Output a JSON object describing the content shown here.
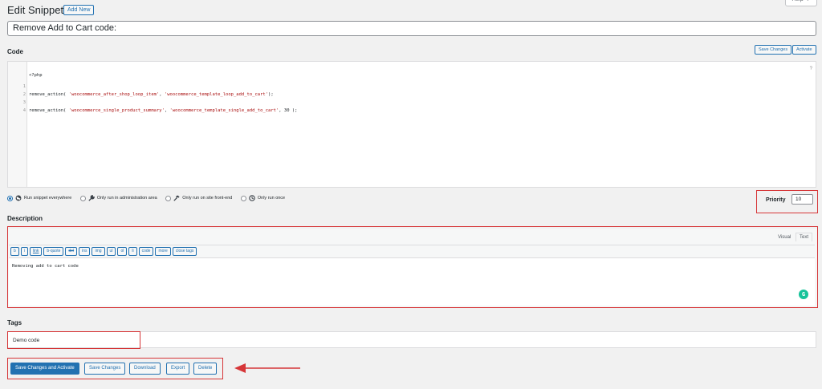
{
  "header": {
    "title": "Edit Snippet",
    "add_new": "Add New",
    "help": "Help ▼"
  },
  "snippet": {
    "name": "Remove Add to Cart code:"
  },
  "code_section": {
    "label": "Code",
    "save_changes": "Save Changes",
    "activate": "Activate",
    "php_tag": "<?php",
    "help_mark": "?",
    "lines": [
      {
        "num": "1",
        "code": "remove_action( 'woocommerce_after_shop_loop_item', 'woocommerce_template_loop_add_to_cart');"
      },
      {
        "num": "2",
        "code": ""
      },
      {
        "num": "3",
        "code": "remove_action( 'woocommerce_single_product_summary', 'woocommerce_template_single_add_to_cart', 30 );"
      },
      {
        "num": "4",
        "code": ""
      }
    ]
  },
  "scope": {
    "options": [
      {
        "label": "Run snippet everywhere",
        "icon": "globe-icon",
        "checked": true
      },
      {
        "label": "Only run in administration area",
        "icon": "wrench-icon",
        "checked": false
      },
      {
        "label": "Only run on site front-end",
        "icon": "hammer-icon",
        "checked": false
      },
      {
        "label": "Only run once",
        "icon": "clock-icon",
        "checked": false
      }
    ]
  },
  "priority": {
    "label": "Priority",
    "value": "10"
  },
  "description": {
    "label": "Description",
    "tab_visual": "Visual",
    "tab_text": "Text",
    "toolbar": [
      "b",
      "i",
      "link",
      "b-quote",
      "del",
      "ins",
      "img",
      "ul",
      "ol",
      "li",
      "code",
      "more",
      "close tags"
    ],
    "content": "Removing add to cart code",
    "grammarly": "G"
  },
  "tags": {
    "label": "Tags",
    "value": "Demo code"
  },
  "actions": {
    "save_and_activate": "Save Changes and Activate",
    "save_changes": "Save Changes",
    "download": "Download",
    "export": "Export",
    "delete": "Delete"
  },
  "colors": {
    "accent": "#2271b1",
    "highlight": "#d63638",
    "string": "#aa1111"
  }
}
